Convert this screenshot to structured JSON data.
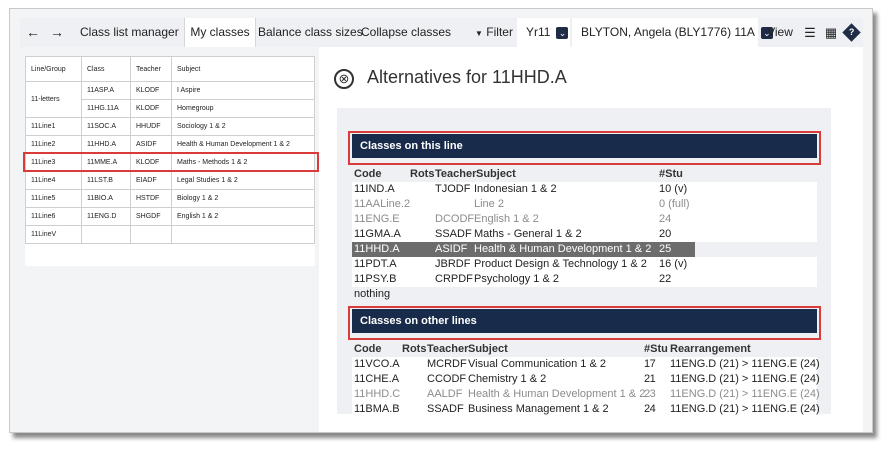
{
  "toolbar": {
    "back_icon": "←",
    "forward_icon": "→",
    "tabs": [
      {
        "label": "Class list manager"
      },
      {
        "label": "My classes"
      },
      {
        "label": "Balance class sizes"
      },
      {
        "label": "Collapse classes"
      }
    ],
    "filter_label": "Filter",
    "filter_icon": "▼",
    "year_value": "Yr11",
    "student_value": "BLYTON, Angela (BLY1776) 11A",
    "view_label": "View",
    "chevron_icon": "⌄",
    "list_icon": "☰",
    "table_icon": "▦",
    "help_icon": "?"
  },
  "left_table": {
    "headers": [
      "Line/Group",
      "Class",
      "Teacher",
      "Subject"
    ],
    "group_11letters": "11-letters",
    "rows": [
      {
        "line": "",
        "class": "11ASP.A",
        "teacher": "KLODF",
        "subject": "I Aspire"
      },
      {
        "line": "",
        "class": "11HG.11A",
        "teacher": "KLODF",
        "subject": "Homegroup"
      },
      {
        "line": "11Line1",
        "class": "11SOC.A",
        "teacher": "HHUDF",
        "subject": "Sociology 1 & 2"
      },
      {
        "line": "11Line2",
        "class": "11HHD.A",
        "teacher": "ASIDF",
        "subject": "Health & Human Development 1 & 2"
      },
      {
        "line": "11Line3",
        "class": "11MME.A",
        "teacher": "KLODF",
        "subject": "Maths - Methods 1 & 2"
      },
      {
        "line": "11Line4",
        "class": "11LST.B",
        "teacher": "EIADF",
        "subject": "Legal Studies 1 & 2"
      },
      {
        "line": "11Line5",
        "class": "11BIO.A",
        "teacher": "HSTDF",
        "subject": "Biology 1 & 2"
      },
      {
        "line": "11Line6",
        "class": "11ENG.D",
        "teacher": "SHGDF",
        "subject": "English 1 & 2"
      },
      {
        "line": "11LineV",
        "class": "",
        "teacher": "",
        "subject": ""
      }
    ]
  },
  "alternatives": {
    "close_icon": "⊗",
    "title": "Alternatives for 11HHD.A",
    "this_line": {
      "heading": "Classes on this line",
      "headers": {
        "code": "Code",
        "rots": "Rots",
        "teacher": "Teacher",
        "subject": "Subject",
        "stu": "#Stu"
      },
      "rows": [
        {
          "code": "11IND.A",
          "teacher": "TJODF",
          "subject": "Indonesian 1 & 2",
          "stu": "10 (v)"
        },
        {
          "code": "11AALine.2",
          "teacher": "",
          "subject": "Line 2",
          "stu": "0 (full)"
        },
        {
          "code": "11ENG.E",
          "teacher": "DCODF",
          "subject": "English 1 & 2",
          "stu": "24"
        },
        {
          "code": "11GMA.A",
          "teacher": "SSADF",
          "subject": "Maths - General 1 & 2",
          "stu": "20"
        },
        {
          "code": "11HHD.A",
          "teacher": "ASIDF",
          "subject": "Health & Human Development 1 & 2",
          "stu": "25"
        },
        {
          "code": "11PDT.A",
          "teacher": "JBRDF",
          "subject": "Product Design & Technology 1 & 2",
          "stu": "16 (v)"
        },
        {
          "code": "11PSY.B",
          "teacher": "CRPDF",
          "subject": "Psychology 1 & 2",
          "stu": "22"
        },
        {
          "code": "nothing",
          "teacher": "",
          "subject": "",
          "stu": ""
        }
      ]
    },
    "other_lines": {
      "heading": "Classes on other lines",
      "headers": {
        "code": "Code",
        "rots": "Rots",
        "teacher": "Teacher",
        "subject": "Subject",
        "stu": "#Stu",
        "rearr": "Rearrangement"
      },
      "rows": [
        {
          "code": "11VCO.A",
          "teacher": "MCRDF",
          "subject": "Visual Communication 1 & 2",
          "stu": "17",
          "rearr": "11ENG.D (21) > 11ENG.E (24)"
        },
        {
          "code": "11CHE.A",
          "teacher": "CCODF",
          "subject": "Chemistry 1 & 2",
          "stu": "21",
          "rearr": "11ENG.D (21) > 11ENG.E (24)"
        },
        {
          "code": "11HHD.C",
          "teacher": "AALDF",
          "subject": "Health & Human Development 1 & 2",
          "stu": "23",
          "rearr": "11ENG.D (21) > 11ENG.E (24)"
        },
        {
          "code": "11BMA.B",
          "teacher": "SSADF",
          "subject": "Business Management 1 & 2",
          "stu": "24",
          "rearr": "11ENG.D (21) > 11ENG.E (24)"
        }
      ]
    }
  },
  "colors": {
    "navy": "#182b4a",
    "highlight_red": "#d93b3b",
    "selected_row": "#6c6c6c"
  }
}
